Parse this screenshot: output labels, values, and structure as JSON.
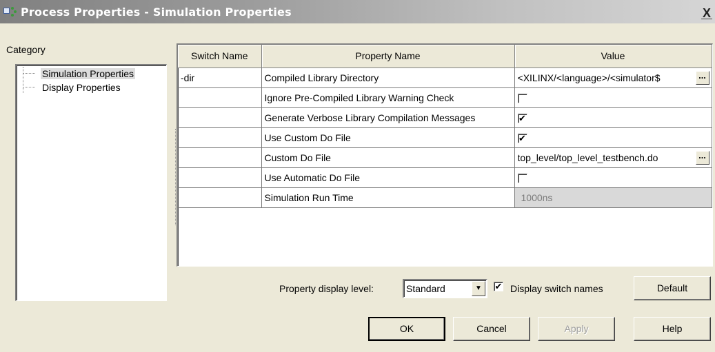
{
  "window": {
    "title": "Process Properties - Simulation Properties",
    "close_glyph": "X",
    "icon": "process-properties-icon"
  },
  "category": {
    "label": "Category",
    "items": [
      {
        "label": "Simulation Properties",
        "selected": true
      },
      {
        "label": "Display Properties",
        "selected": false
      }
    ]
  },
  "grid": {
    "headers": [
      "Switch Name",
      "Property Name",
      "Value"
    ],
    "rows": [
      {
        "switch": "-dir",
        "property": "Compiled Library Directory",
        "value_type": "text_browse",
        "value": "$XILINX/<language>/<simulator>"
      },
      {
        "switch": "",
        "property": "Ignore Pre-Compiled Library Warning Check",
        "value_type": "checkbox",
        "checked": false
      },
      {
        "switch": "",
        "property": "Generate Verbose Library Compilation Messages",
        "value_type": "checkbox",
        "checked": true
      },
      {
        "switch": "",
        "property": "Use Custom Do File",
        "value_type": "checkbox",
        "checked": true
      },
      {
        "switch": "",
        "property": "Custom Do File",
        "value_type": "text_browse",
        "value": "top_level/top_level_testbench.do"
      },
      {
        "switch": "",
        "property": "Use Automatic Do File",
        "value_type": "checkbox",
        "checked": false
      },
      {
        "switch": "",
        "property": "Simulation Run Time",
        "value_type": "text_disabled",
        "value": "1000ns"
      }
    ],
    "browse_label": "..."
  },
  "controls": {
    "display_level_label": "Property display level:",
    "display_level_value": "Standard",
    "display_switch_label": "Display switch names",
    "display_switch_checked": true,
    "default_label": "Default"
  },
  "buttons": {
    "ok": "OK",
    "cancel": "Cancel",
    "apply": "Apply",
    "help": "Help"
  },
  "colors": {
    "dialog_bg": "#ece9d8",
    "titlebar_gradient_start": "#808080",
    "disabled_cell": "#d9d9d9"
  }
}
